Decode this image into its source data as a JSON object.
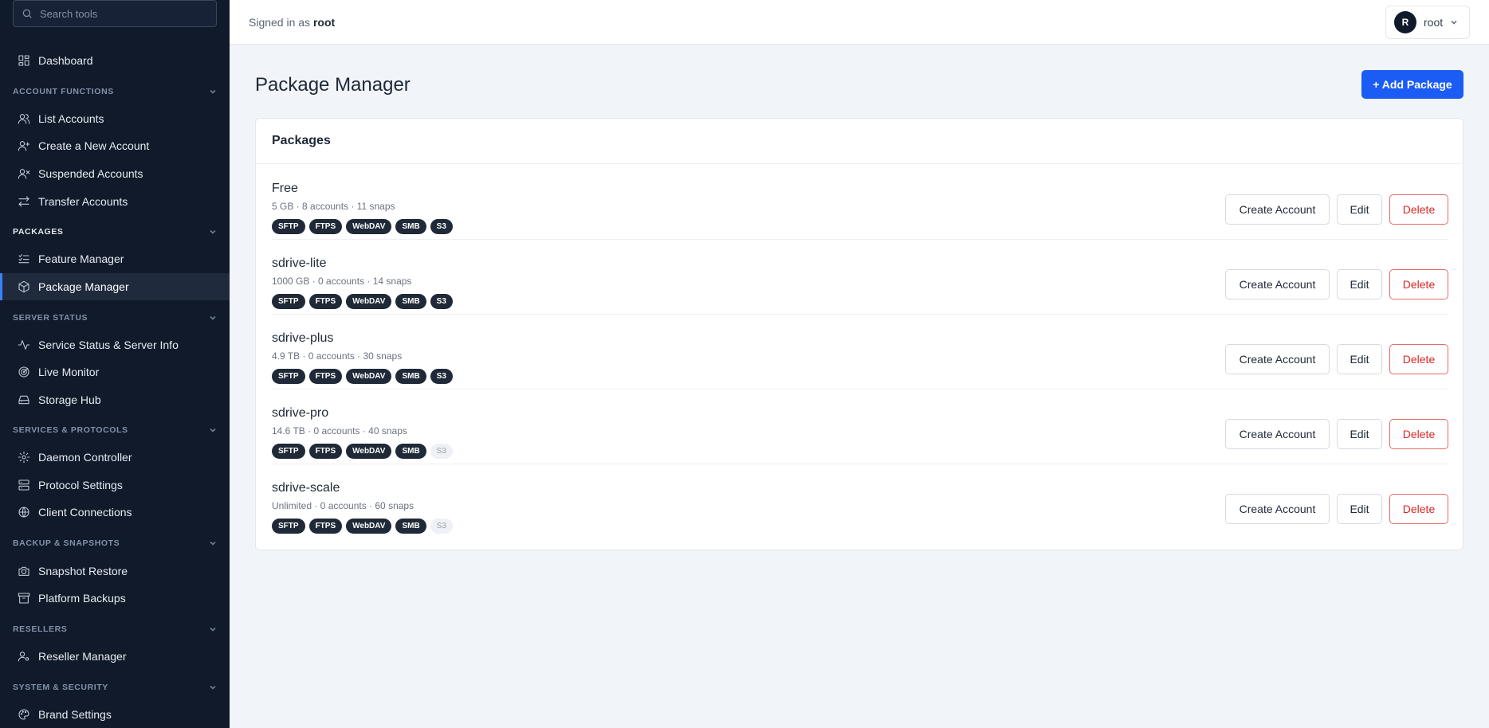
{
  "sidebar": {
    "search_placeholder": "Search tools",
    "dashboard": "Dashboard",
    "sections": {
      "account_functions": "ACCOUNT FUNCTIONS",
      "packages": "PACKAGES",
      "server_status": "SERVER STATUS",
      "services_protocols": "SERVICES & PROTOCOLS",
      "backup_snapshots": "BACKUP & SNAPSHOTS",
      "resellers": "RESELLERS",
      "system_security": "SYSTEM & SECURITY"
    },
    "items": {
      "list_accounts": "List Accounts",
      "create_account": "Create a New Account",
      "suspended_accounts": "Suspended Accounts",
      "transfer_accounts": "Transfer Accounts",
      "feature_manager": "Feature Manager",
      "package_manager": "Package Manager",
      "service_status": "Service Status & Server Info",
      "live_monitor": "Live Monitor",
      "storage_hub": "Storage Hub",
      "daemon_controller": "Daemon Controller",
      "protocol_settings": "Protocol Settings",
      "client_connections": "Client Connections",
      "snapshot_restore": "Snapshot Restore",
      "platform_backups": "Platform Backups",
      "reseller_manager": "Reseller Manager",
      "brand_settings": "Brand Settings"
    },
    "active_item": "Package Manager",
    "accent_color": "#3b82f6"
  },
  "header": {
    "signed_in_prefix": "Signed in as",
    "username": "root",
    "avatar_initial": "R",
    "user_menu_label": "root"
  },
  "main": {
    "title": "Package Manager",
    "add_button": "+ Add Package",
    "card_title": "Packages",
    "action_labels": {
      "create": "Create Account",
      "edit": "Edit",
      "delete": "Delete"
    },
    "packages": [
      {
        "name": "Free",
        "meta": "5 GB · 8 accounts · 11 snaps",
        "protocols": [
          {
            "label": "SFTP",
            "enabled": true
          },
          {
            "label": "FTPS",
            "enabled": true
          },
          {
            "label": "WebDAV",
            "enabled": true
          },
          {
            "label": "SMB",
            "enabled": true
          },
          {
            "label": "S3",
            "enabled": true
          }
        ]
      },
      {
        "name": "sdrive-lite",
        "meta": "1000 GB · 0 accounts · 14 snaps",
        "protocols": [
          {
            "label": "SFTP",
            "enabled": true
          },
          {
            "label": "FTPS",
            "enabled": true
          },
          {
            "label": "WebDAV",
            "enabled": true
          },
          {
            "label": "SMB",
            "enabled": true
          },
          {
            "label": "S3",
            "enabled": true
          }
        ]
      },
      {
        "name": "sdrive-plus",
        "meta": "4.9 TB · 0 accounts · 30 snaps",
        "protocols": [
          {
            "label": "SFTP",
            "enabled": true
          },
          {
            "label": "FTPS",
            "enabled": true
          },
          {
            "label": "WebDAV",
            "enabled": true
          },
          {
            "label": "SMB",
            "enabled": true
          },
          {
            "label": "S3",
            "enabled": true
          }
        ]
      },
      {
        "name": "sdrive-pro",
        "meta": "14.6 TB · 0 accounts · 40 snaps",
        "protocols": [
          {
            "label": "SFTP",
            "enabled": true
          },
          {
            "label": "FTPS",
            "enabled": true
          },
          {
            "label": "WebDAV",
            "enabled": true
          },
          {
            "label": "SMB",
            "enabled": true
          },
          {
            "label": "S3",
            "enabled": false
          }
        ]
      },
      {
        "name": "sdrive-scale",
        "meta": "Unlimited · 0 accounts · 60 snaps",
        "protocols": [
          {
            "label": "SFTP",
            "enabled": true
          },
          {
            "label": "FTPS",
            "enabled": true
          },
          {
            "label": "WebDAV",
            "enabled": true
          },
          {
            "label": "SMB",
            "enabled": true
          },
          {
            "label": "S3",
            "enabled": false
          }
        ]
      }
    ],
    "primary_color": "#1b5cf5",
    "danger_color": "#dc2626"
  }
}
